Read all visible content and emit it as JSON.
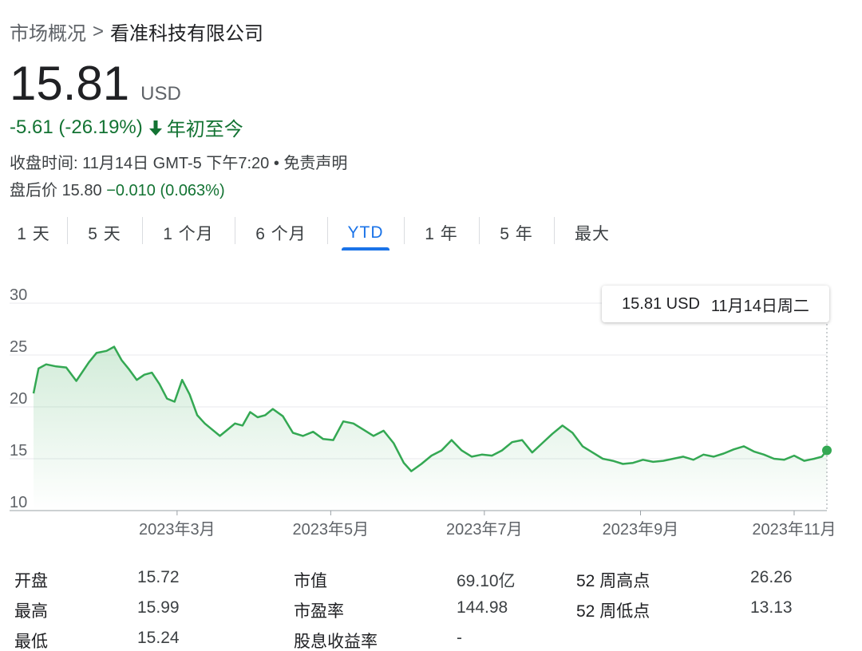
{
  "breadcrumb": {
    "root": "市场概况",
    "separator": ">",
    "current": "看准科技有限公司"
  },
  "quote": {
    "price": "15.81",
    "currency": "USD",
    "change": "-5.61 (-26.19%)",
    "period": "年初至今",
    "close_info": "收盘时间: 11月14日 GMT-5 下午7:20 • 免责声明",
    "after_hours_label": "盘后价",
    "after_hours_price": "15.80",
    "after_hours_change": "−0.010 (0.063%)"
  },
  "tabs": [
    {
      "label": "1 天",
      "active": false
    },
    {
      "label": "5 天",
      "active": false
    },
    {
      "label": "1 个月",
      "active": false
    },
    {
      "label": "6 个月",
      "active": false
    },
    {
      "label": "YTD",
      "active": true
    },
    {
      "label": "1 年",
      "active": false
    },
    {
      "label": "5 年",
      "active": false
    },
    {
      "label": "最大",
      "active": false
    }
  ],
  "tooltip": {
    "price": "15.81 USD",
    "date": "11月14日周二"
  },
  "colors": {
    "line": "#34a853",
    "positive_text": "#137333",
    "active_tab": "#1a73e8"
  },
  "chart_data": {
    "type": "area",
    "title": "",
    "xlabel": "",
    "ylabel": "",
    "ylim": [
      10,
      30
    ],
    "yticks": [
      "10",
      "15",
      "20",
      "25",
      "30"
    ],
    "xlim": [
      "2023-01-03",
      "2023-11-14"
    ],
    "xticks": [
      {
        "date": "2023-03-01",
        "label": "2023年3月"
      },
      {
        "date": "2023-05-01",
        "label": "2023年5月"
      },
      {
        "date": "2023-07-01",
        "label": "2023年7月"
      },
      {
        "date": "2023-09-01",
        "label": "2023年9月"
      },
      {
        "date": "2023-11-01",
        "label": "2023年11月"
      }
    ],
    "grid": true,
    "series": [
      {
        "x": [
          "2023-01-03",
          "2023-01-05",
          "2023-01-08",
          "2023-01-12",
          "2023-01-16",
          "2023-01-20",
          "2023-01-25",
          "2023-01-28",
          "2023-02-01",
          "2023-02-04",
          "2023-02-07",
          "2023-02-10",
          "2023-02-13",
          "2023-02-16",
          "2023-02-19",
          "2023-02-22",
          "2023-02-25",
          "2023-02-28",
          "2023-03-03",
          "2023-03-06",
          "2023-03-09",
          "2023-03-12",
          "2023-03-15",
          "2023-03-18",
          "2023-03-21",
          "2023-03-24",
          "2023-03-27",
          "2023-03-30",
          "2023-04-02",
          "2023-04-05",
          "2023-04-08",
          "2023-04-12",
          "2023-04-16",
          "2023-04-20",
          "2023-04-24",
          "2023-04-28",
          "2023-05-02",
          "2023-05-06",
          "2023-05-10",
          "2023-05-14",
          "2023-05-18",
          "2023-05-22",
          "2023-05-26",
          "2023-05-30",
          "2023-06-02",
          "2023-06-06",
          "2023-06-10",
          "2023-06-14",
          "2023-06-18",
          "2023-06-22",
          "2023-06-26",
          "2023-06-30",
          "2023-07-04",
          "2023-07-08",
          "2023-07-12",
          "2023-07-16",
          "2023-07-20",
          "2023-07-24",
          "2023-07-28",
          "2023-08-01",
          "2023-08-05",
          "2023-08-09",
          "2023-08-13",
          "2023-08-17",
          "2023-08-21",
          "2023-08-25",
          "2023-08-29",
          "2023-09-02",
          "2023-09-06",
          "2023-09-10",
          "2023-09-14",
          "2023-09-18",
          "2023-09-22",
          "2023-09-26",
          "2023-09-30",
          "2023-10-04",
          "2023-10-08",
          "2023-10-12",
          "2023-10-16",
          "2023-10-20",
          "2023-10-24",
          "2023-10-28",
          "2023-11-01",
          "2023-11-05",
          "2023-11-09",
          "2023-11-12",
          "2023-11-14"
        ],
        "values": [
          21.3,
          23.7,
          24.1,
          23.9,
          23.8,
          22.5,
          24.3,
          25.2,
          25.4,
          25.8,
          24.5,
          23.6,
          22.6,
          23.1,
          23.3,
          22.2,
          20.8,
          20.5,
          22.6,
          21.2,
          19.2,
          18.4,
          17.8,
          17.2,
          17.8,
          18.4,
          18.2,
          19.5,
          19.0,
          19.2,
          19.8,
          19.1,
          17.5,
          17.2,
          17.6,
          16.9,
          16.8,
          18.6,
          18.4,
          17.8,
          17.2,
          17.7,
          16.5,
          14.6,
          13.8,
          14.5,
          15.3,
          15.8,
          16.8,
          15.8,
          15.2,
          15.4,
          15.3,
          15.8,
          16.6,
          16.8,
          15.6,
          16.5,
          17.4,
          18.2,
          17.5,
          16.2,
          15.6,
          15.0,
          14.8,
          14.5,
          14.6,
          14.9,
          14.7,
          14.8,
          15.0,
          15.2,
          14.9,
          15.4,
          15.2,
          15.5,
          15.9,
          16.2,
          15.7,
          15.4,
          15.0,
          14.9,
          15.3,
          14.8,
          15.0,
          15.2,
          15.81
        ]
      }
    ]
  },
  "stats": [
    {
      "label": "开盘",
      "value": "15.72"
    },
    {
      "label": "市值",
      "value": "69.10亿"
    },
    {
      "label": "52 周高点",
      "value": "26.26"
    },
    {
      "label": "最高",
      "value": "15.99"
    },
    {
      "label": "市盈率",
      "value": "144.98"
    },
    {
      "label": "52 周低点",
      "value": "13.13"
    },
    {
      "label": "最低",
      "value": "15.24"
    },
    {
      "label": "股息收益率",
      "value": "-"
    }
  ]
}
